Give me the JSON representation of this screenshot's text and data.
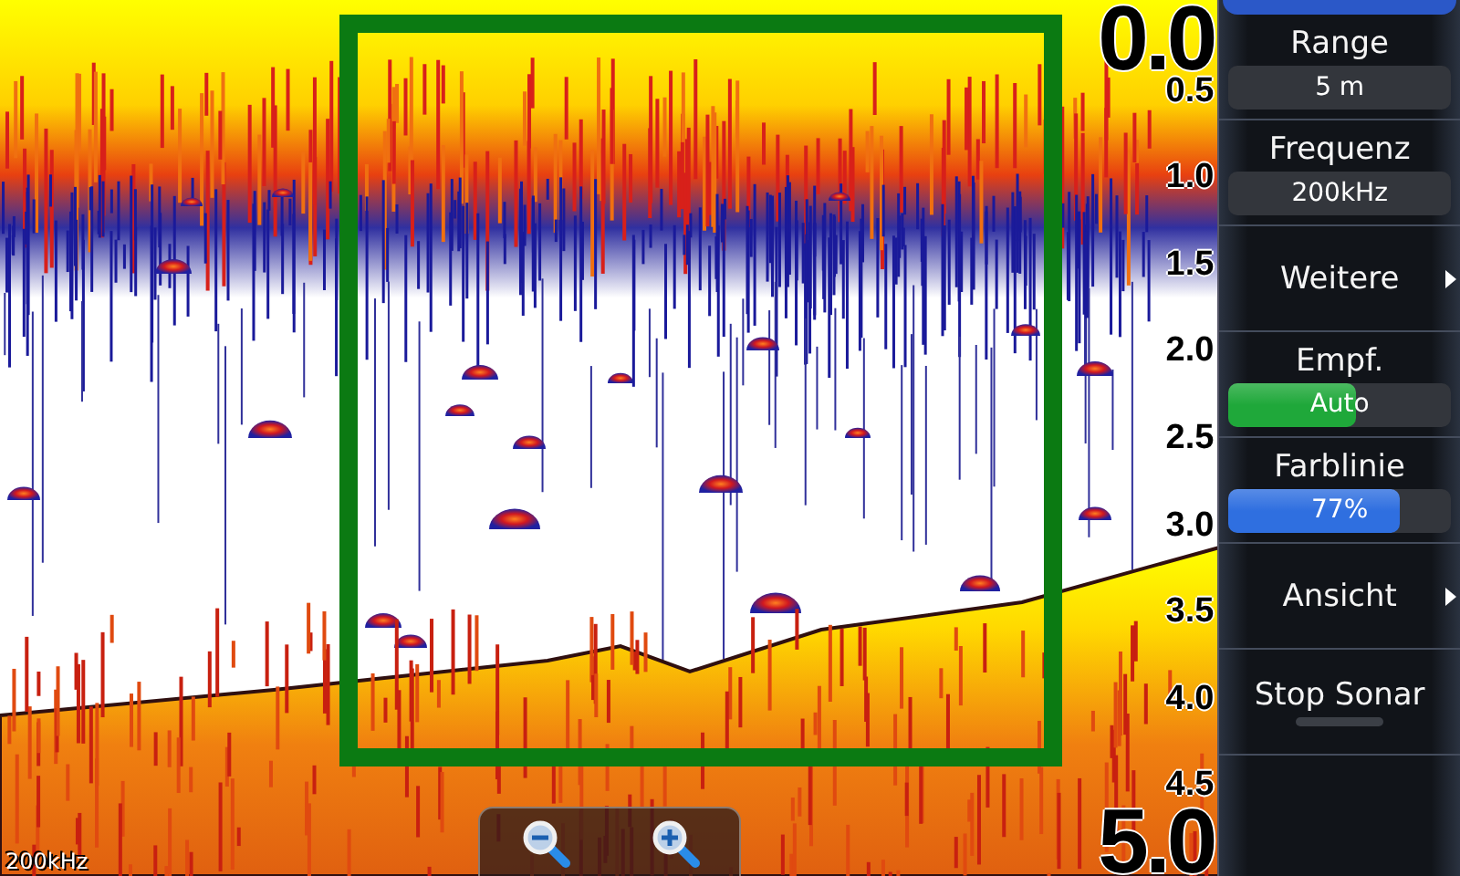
{
  "sonar": {
    "frequency_label": "200kHz",
    "depth_scale": [
      {
        "text": "0.0",
        "kind": "major"
      },
      {
        "text": "0.5",
        "kind": "minor"
      },
      {
        "text": "1.0",
        "kind": "minor"
      },
      {
        "text": "1.5",
        "kind": "minor"
      },
      {
        "text": "2.0",
        "kind": "minor"
      },
      {
        "text": "2.5",
        "kind": "minor"
      },
      {
        "text": "3.0",
        "kind": "minor"
      },
      {
        "text": "3.5",
        "kind": "minor"
      },
      {
        "text": "4.0",
        "kind": "minor"
      },
      {
        "text": "4.5",
        "kind": "minor"
      },
      {
        "text": "5.0",
        "kind": "major"
      }
    ]
  },
  "menu": {
    "items": [
      {
        "kind": "value",
        "label": "Range",
        "value": "5 m"
      },
      {
        "kind": "value",
        "label": "Frequenz",
        "value": "200kHz"
      },
      {
        "kind": "submenu",
        "label": "Weitere"
      },
      {
        "kind": "slider",
        "label": "Empf.",
        "value": "Auto",
        "level": 0.57,
        "color": "#1fa83a"
      },
      {
        "kind": "slider",
        "label": "Farblinie",
        "value": "77%",
        "level": 0.77,
        "color": "#2f6fe0"
      },
      {
        "kind": "submenu",
        "label": "Ansicht"
      },
      {
        "kind": "toggle",
        "label": "Stop Sonar",
        "on": false
      }
    ]
  }
}
